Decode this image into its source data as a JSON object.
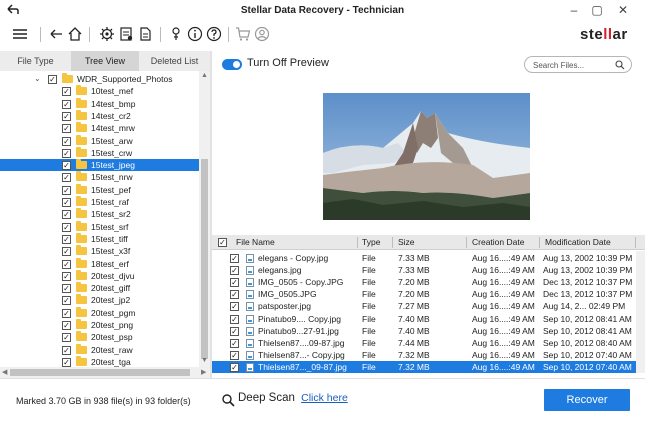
{
  "window": {
    "title": "Stellar Data Recovery - Technician",
    "brand_prefix": "ste",
    "brand_mid": "ll",
    "brand_suffix": "ar"
  },
  "left_panel": {
    "tabs": [
      {
        "label": "File Type",
        "active": false
      },
      {
        "label": "Tree View",
        "active": true
      },
      {
        "label": "Deleted List",
        "active": false
      }
    ],
    "root_folder": "WDR_Supported_Photos",
    "folders": [
      {
        "label": "10test_mef",
        "selected": false
      },
      {
        "label": "14test_bmp",
        "selected": false
      },
      {
        "label": "14test_cr2",
        "selected": false
      },
      {
        "label": "14test_mrw",
        "selected": false
      },
      {
        "label": "15test_arw",
        "selected": false
      },
      {
        "label": "15test_crw",
        "selected": false
      },
      {
        "label": "15test_jpeg",
        "selected": true
      },
      {
        "label": "15test_nrw",
        "selected": false
      },
      {
        "label": "15test_pef",
        "selected": false
      },
      {
        "label": "15test_raf",
        "selected": false
      },
      {
        "label": "15test_sr2",
        "selected": false
      },
      {
        "label": "15test_srf",
        "selected": false
      },
      {
        "label": "15test_tiff",
        "selected": false
      },
      {
        "label": "15test_x3f",
        "selected": false
      },
      {
        "label": "18test_erf",
        "selected": false
      },
      {
        "label": "20test_djvu",
        "selected": false
      },
      {
        "label": "20test_giff",
        "selected": false
      },
      {
        "label": "20test_jp2",
        "selected": false
      },
      {
        "label": "20test_pgm",
        "selected": false
      },
      {
        "label": "20test_png",
        "selected": false
      },
      {
        "label": "20test_psp",
        "selected": false
      },
      {
        "label": "20test_raw",
        "selected": false
      },
      {
        "label": "20test_tga",
        "selected": false
      }
    ]
  },
  "preview": {
    "toggle_label": "Turn Off Preview",
    "toggle_on": true,
    "search_placeholder": "Search Files..."
  },
  "table": {
    "columns": [
      "File Name",
      "Type",
      "Size",
      "Creation Date",
      "Modification Date"
    ],
    "rows": [
      {
        "name": "elegans - Copy.jpg",
        "type": "File",
        "size": "7.33 MB",
        "created": "Aug 16....:49 AM",
        "modified": "Aug 13, 2002 10:39 PM",
        "selected": false
      },
      {
        "name": "elegans.jpg",
        "type": "File",
        "size": "7.33 MB",
        "created": "Aug 16....:49 AM",
        "modified": "Aug 13, 2002 10:39 PM",
        "selected": false
      },
      {
        "name": "IMG_0505 - Copy.JPG",
        "type": "File",
        "size": "7.20 MB",
        "created": "Aug 16....:49 AM",
        "modified": "Dec 13, 2012 10:37 PM",
        "selected": false
      },
      {
        "name": "IMG_0505.JPG",
        "type": "File",
        "size": "7.20 MB",
        "created": "Aug 16....:49 AM",
        "modified": "Dec 13, 2012 10:37 PM",
        "selected": false
      },
      {
        "name": "patsposter.jpg",
        "type": "File",
        "size": "7.27 MB",
        "created": "Aug 16....:49 AM",
        "modified": "Aug 14, 2... 02:49 PM",
        "selected": false
      },
      {
        "name": "Pinatubo9.... Copy.jpg",
        "type": "File",
        "size": "7.40 MB",
        "created": "Aug 16....:49 AM",
        "modified": "Sep 10, 2012 08:41 AM",
        "selected": false
      },
      {
        "name": "Pinatubo9...27-91.jpg",
        "type": "File",
        "size": "7.40 MB",
        "created": "Aug 16....:49 AM",
        "modified": "Sep 10, 2012 08:41 AM",
        "selected": false
      },
      {
        "name": "Thielsen87....09-87.jpg",
        "type": "File",
        "size": "7.44 MB",
        "created": "Aug 16....:49 AM",
        "modified": "Sep 10, 2012 08:40 AM",
        "selected": false
      },
      {
        "name": "Thielsen87...- Copy.jpg",
        "type": "File",
        "size": "7.32 MB",
        "created": "Aug 16....:49 AM",
        "modified": "Sep 10, 2012 07:40 AM",
        "selected": false
      },
      {
        "name": "Thielsen87..._09-87.jpg",
        "type": "File",
        "size": "7.32 MB",
        "created": "Aug 16....:49 AM",
        "modified": "Sep 10, 2012 07:40 AM",
        "selected": true
      }
    ]
  },
  "footer": {
    "status": "Marked 3.70 GB in 938 file(s) in 93 folder(s)",
    "deep_scan_label": "Deep Scan",
    "deep_scan_link": "Click here",
    "recover_label": "Recover"
  },
  "icons": {
    "back": "back-arrow-icon",
    "menu": "hamburger-menu-icon",
    "home": "home-icon",
    "settings": "gear-icon",
    "save_scan": "save-scan-icon",
    "log": "log-file-icon",
    "info": "info-icon",
    "help": "help-icon",
    "cart": "cart-icon",
    "account": "account-icon"
  },
  "colors": {
    "accent": "#1e7be0",
    "folder": "#f5c542",
    "brand_red": "#d3212c"
  }
}
